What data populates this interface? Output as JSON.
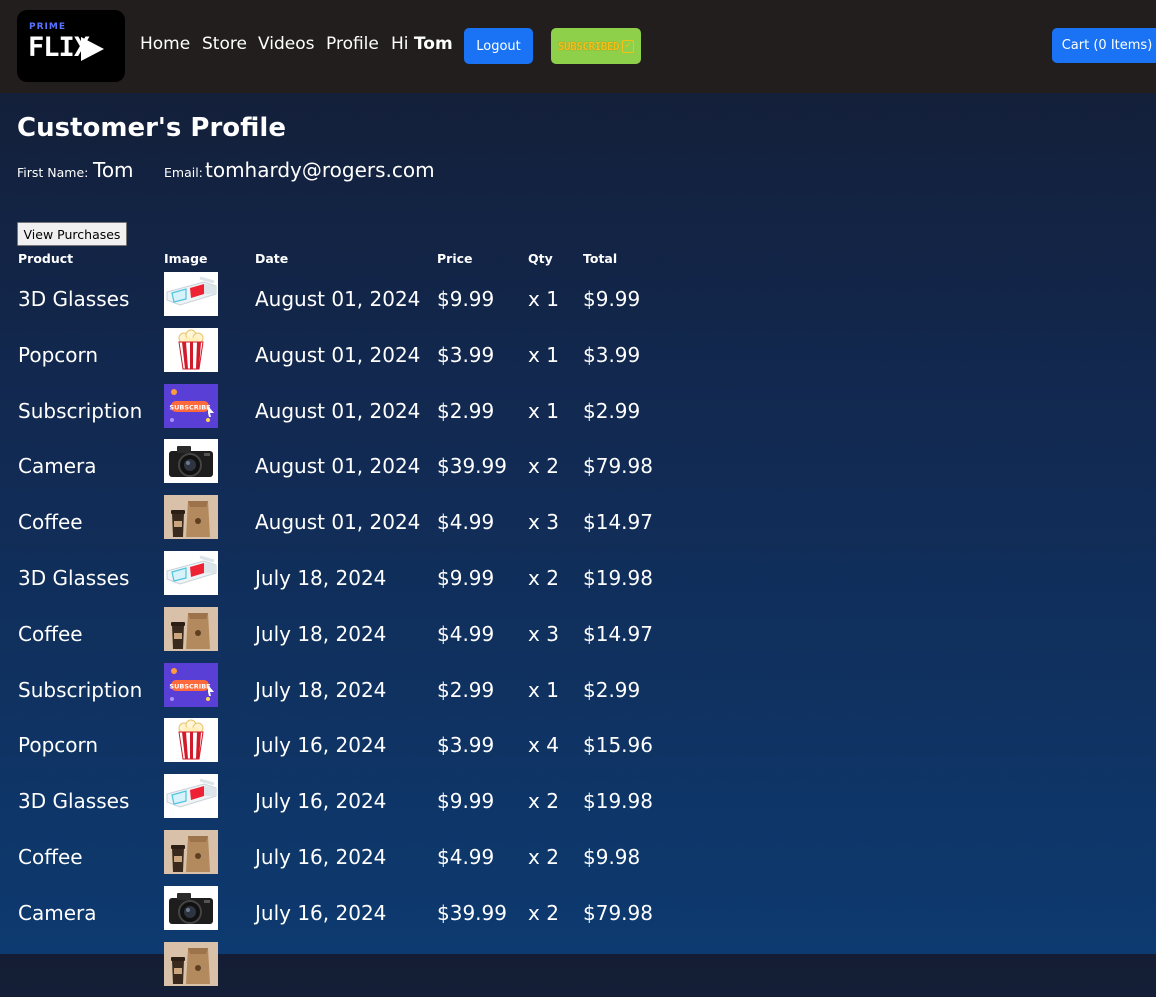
{
  "nav": {
    "logo_top": "PRIME",
    "logo_main": "FLIX",
    "links": [
      "Home",
      "Store",
      "Videos",
      "Profile"
    ],
    "greeting_prefix": "Hi",
    "user_name": "Tom",
    "logout_label": "Logout",
    "subscribed_label": "SUBSCRIBED",
    "cart_label": "Cart (0 Items)"
  },
  "profile": {
    "title": "Customer's Profile",
    "first_name_label": "First Name:",
    "first_name": "Tom",
    "email_label": "Email:",
    "email": "tomhardy@rogers.com",
    "view_purchases_label": "View Purchases"
  },
  "table": {
    "headers": [
      "Product",
      "Image",
      "Date",
      "Price",
      "Qty",
      "Total"
    ],
    "rows": [
      {
        "product": "3D Glasses",
        "image": "3d-glasses",
        "date": "August 01, 2024",
        "price": "$9.99",
        "qty": "x 1",
        "total": "$9.99"
      },
      {
        "product": "Popcorn",
        "image": "popcorn",
        "date": "August 01, 2024",
        "price": "$3.99",
        "qty": "x 1",
        "total": "$3.99"
      },
      {
        "product": "Subscription",
        "image": "subscription",
        "date": "August 01, 2024",
        "price": "$2.99",
        "qty": "x 1",
        "total": "$2.99"
      },
      {
        "product": "Camera",
        "image": "camera",
        "date": "August 01, 2024",
        "price": "$39.99",
        "qty": "x 2",
        "total": "$79.98"
      },
      {
        "product": "Coffee",
        "image": "coffee",
        "date": "August 01, 2024",
        "price": "$4.99",
        "qty": "x 3",
        "total": "$14.97"
      },
      {
        "product": "3D Glasses",
        "image": "3d-glasses",
        "date": "July 18, 2024",
        "price": "$9.99",
        "qty": "x 2",
        "total": "$19.98"
      },
      {
        "product": "Coffee",
        "image": "coffee",
        "date": "July 18, 2024",
        "price": "$4.99",
        "qty": "x 3",
        "total": "$14.97"
      },
      {
        "product": "Subscription",
        "image": "subscription",
        "date": "July 18, 2024",
        "price": "$2.99",
        "qty": "x 1",
        "total": "$2.99"
      },
      {
        "product": "Popcorn",
        "image": "popcorn",
        "date": "July 16, 2024",
        "price": "$3.99",
        "qty": "x 4",
        "total": "$15.96"
      },
      {
        "product": "3D Glasses",
        "image": "3d-glasses",
        "date": "July 16, 2024",
        "price": "$9.99",
        "qty": "x 2",
        "total": "$19.98"
      },
      {
        "product": "Coffee",
        "image": "coffee",
        "date": "July 16, 2024",
        "price": "$4.99",
        "qty": "x 2",
        "total": "$9.98"
      },
      {
        "product": "Camera",
        "image": "camera",
        "date": "July 16, 2024",
        "price": "$39.99",
        "qty": "x 2",
        "total": "$79.98"
      },
      {
        "product": "",
        "image": "coffee",
        "date": "",
        "price": "",
        "qty": "",
        "total": ""
      }
    ]
  },
  "colors": {
    "navbar_bg": "#221e1e",
    "button_blue": "#1a73f5",
    "subscribed_green": "#8fd04a",
    "page_gradient_top": "#141d33",
    "page_gradient_bottom": "#0d3a70"
  }
}
